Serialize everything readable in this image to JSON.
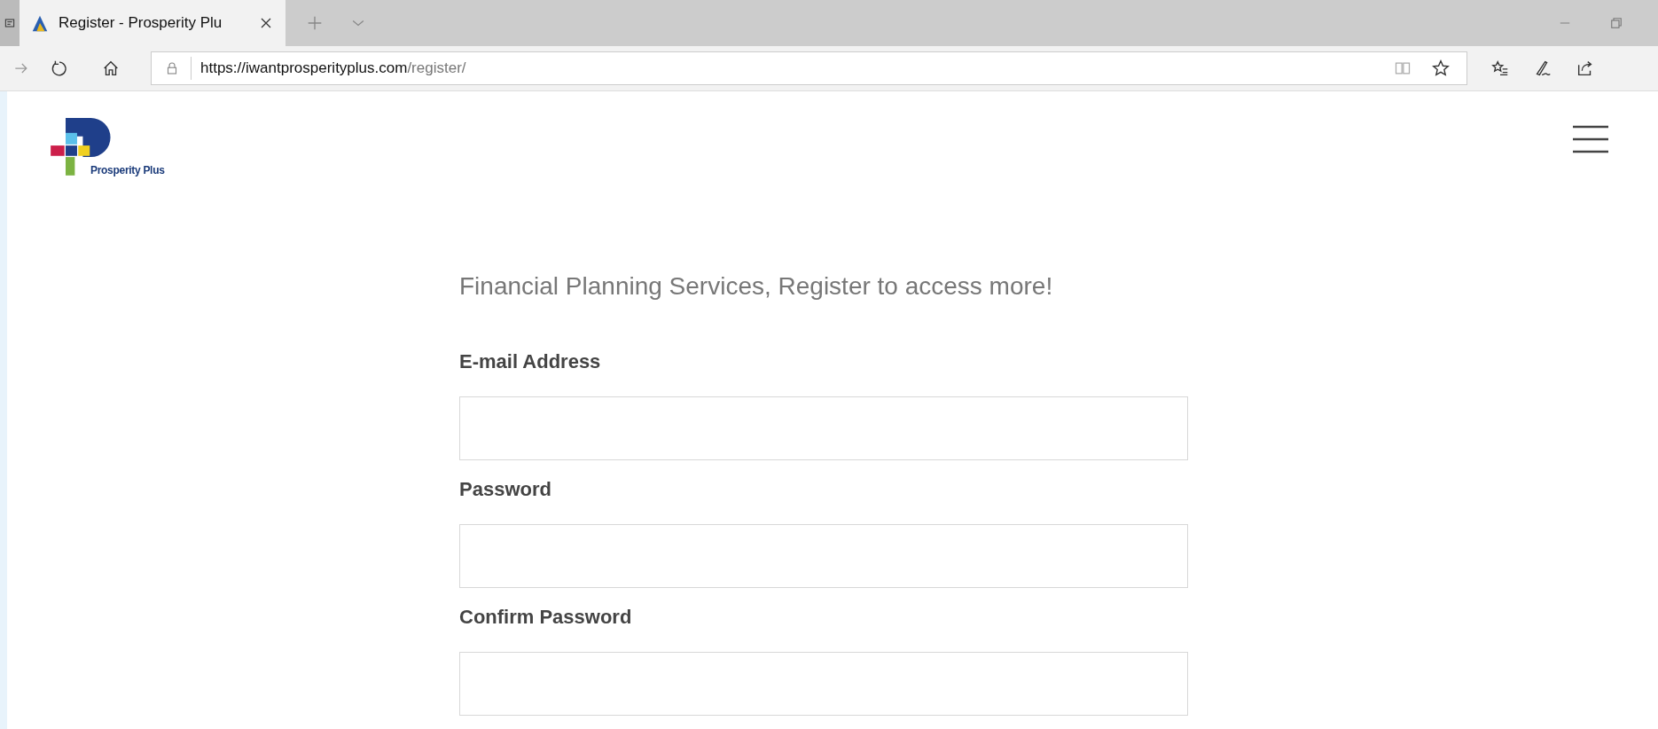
{
  "browser": {
    "tab": {
      "title": "Register - Prosperity Plu",
      "selected": true
    },
    "url": {
      "host": "https://iwantprosperityplus.com",
      "path": "/register/"
    }
  },
  "logo": {
    "text": "Prosperity Plus"
  },
  "form": {
    "heading": "Financial Planning Services, Register to access more!",
    "fields": [
      {
        "label": "E-mail Address"
      },
      {
        "label": "Password"
      },
      {
        "label": "Confirm Password"
      }
    ]
  }
}
